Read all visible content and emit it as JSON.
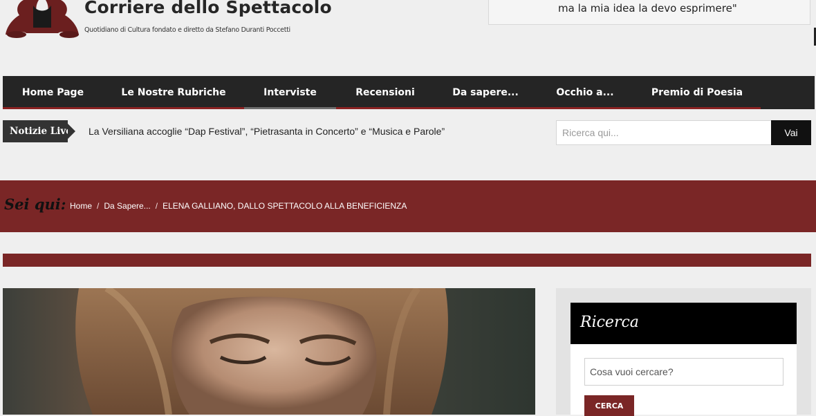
{
  "header": {
    "site_title": "Corriere dello Spettacolo",
    "tagline": "Quotidiano di Cultura fondato e diretto da Stefano Duranti Poccetti",
    "quote": "ma la mia idea la devo esprimere\""
  },
  "nav": {
    "items": [
      {
        "label": "Home Page"
      },
      {
        "label": "Le Nostre Rubriche"
      },
      {
        "label": "Interviste"
      },
      {
        "label": "Recensioni"
      },
      {
        "label": "Da sapere..."
      },
      {
        "label": "Occhio a..."
      },
      {
        "label": "Premio di Poesia"
      }
    ]
  },
  "ticker": {
    "label": "Notizie Live",
    "headline": "La Versiliana accoglie “Dap Festival”, “Pietrasanta in Concerto” e “Musica e Parole”"
  },
  "top_search": {
    "placeholder": "Ricerca qui...",
    "button_label": "Vai"
  },
  "breadcrumb": {
    "label": "Sei qui:",
    "items": [
      "Home",
      "Da Sapere...",
      "ELENA GALLIANO, DALLO SPETTACOLO ALLA BENEFICIENZA"
    ],
    "separator": "/"
  },
  "sidebar": {
    "widget_title": "Ricerca",
    "search_placeholder": "Cosa vuoi cercare?",
    "button_label": "CERCA"
  },
  "colors": {
    "brand": "#7a2626",
    "nav_bg": "#252525",
    "page_bg": "#efefef"
  }
}
